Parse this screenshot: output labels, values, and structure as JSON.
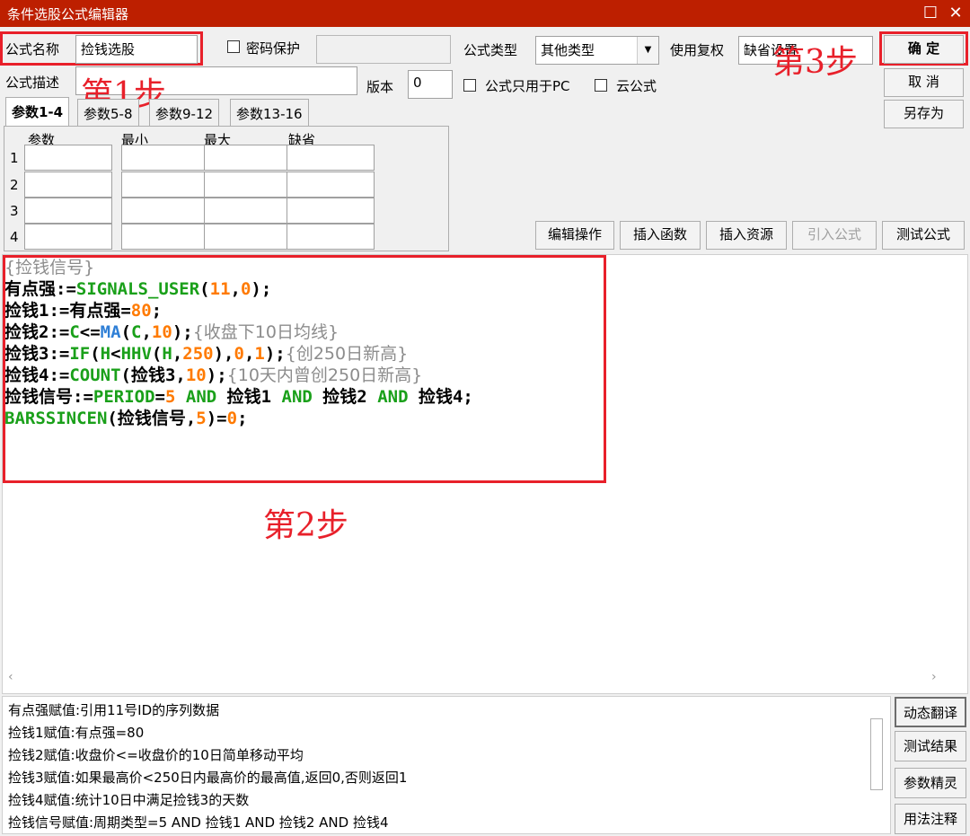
{
  "window": {
    "title": "条件选股公式编辑器",
    "restore_glyph": "☐",
    "close_glyph": "✕"
  },
  "form": {
    "name_label": "公式名称",
    "name_value": "捡钱选股",
    "password_label": "密码保护",
    "type_label": "公式类型",
    "type_value": "其他类型",
    "fuquan_label": "使用复权",
    "fuquan_value": "缺省设置",
    "desc_label": "公式描述",
    "desc_value": "",
    "version_label": "版本",
    "version_value": "0",
    "pc_only_label": "公式只用于PC",
    "cloud_label": "云公式"
  },
  "buttons": {
    "ok": "确  定",
    "cancel": "取  消",
    "save_as": "另存为",
    "edit_ops": "编辑操作",
    "insert_func": "插入函数",
    "insert_res": "插入资源",
    "import_formula": "引入公式",
    "test_formula": "测试公式"
  },
  "tabs": [
    "参数1-4",
    "参数5-8",
    "参数9-12",
    "参数13-16"
  ],
  "params": {
    "headers": [
      "参数",
      "最小",
      "最大",
      "缺省"
    ],
    "rows": [
      "1",
      "2",
      "3",
      "4"
    ]
  },
  "annotations": {
    "step1": "第1步",
    "step2": "第2步",
    "step3": "第3步"
  },
  "code": {
    "l1_comment": "{捡钱信号}",
    "l2_a": "有点强:=",
    "l2_fn": "SIGNALS_USER",
    "l2_b": "(",
    "l2_n1": "11",
    "l2_c": ",",
    "l2_n2": "0",
    "l2_d": ");",
    "l3_a": "捡钱1:=有点强=",
    "l3_n": "80",
    "l3_b": ";",
    "l4_a": "捡钱2:=",
    "l4_c": "C",
    "l4_b": "<=",
    "l4_fn": "MA",
    "l4_p1": "(",
    "l4_c2": "C",
    "l4_p2": ",",
    "l4_n": "10",
    "l4_p3": ");",
    "l4_cm": "{收盘下10日均线}",
    "l5_a": "捡钱3:=",
    "l5_fn": "IF",
    "l5_b": "(",
    "l5_h": "H",
    "l5_lt": "<",
    "l5_fn2": "HHV",
    "l5_p": "(",
    "l5_h2": "H",
    "l5_cm1": ",",
    "l5_n1": "250",
    "l5_c": "),",
    "l5_n2": "0",
    "l5_c2": ",",
    "l5_n3": "1",
    "l5_e": ");",
    "l5_cm": "{创250日新高}",
    "l6_a": "捡钱4:=",
    "l6_fn": "COUNT",
    "l6_b": "(捡钱3,",
    "l6_n": "10",
    "l6_e": ");",
    "l6_cm": "{10天内曾创250日新高}",
    "l7_a": "捡钱信号:=",
    "l7_fn": "PERIOD",
    "l7_b": "=",
    "l7_n": "5",
    "l7_and1": " AND ",
    "l7_c": "捡钱1",
    "l7_and2": " AND ",
    "l7_d": "捡钱2",
    "l7_and3": " AND ",
    "l7_e": "捡钱4;",
    "l8_fn": "BARSSINCEN",
    "l8_a": "(捡钱信号,",
    "l8_n": "5",
    "l8_b": ")=",
    "l8_n2": "0",
    "l8_c": ";"
  },
  "translation": [
    "有点强赋值:引用11号ID的序列数据",
    "捡钱1赋值:有点强=80",
    "捡钱2赋值:收盘价<=收盘价的10日简单移动平均",
    "捡钱3赋值:如果最高价<250日内最高价的最高值,返回0,否则返回1",
    "捡钱4赋值:统计10日中满足捡钱3的天数",
    "捡钱信号赋值:周期类型=5 AND 捡钱1 AND 捡钱2 AND 捡钱4"
  ],
  "side_buttons": [
    "动态翻译",
    "测试结果",
    "参数精灵",
    "用法注释"
  ],
  "colors": {
    "titlebar": "#bd1f00",
    "annotation_red": "#e8202a",
    "keyword_green": "#1aa01a",
    "number_orange": "#ff7a00"
  }
}
